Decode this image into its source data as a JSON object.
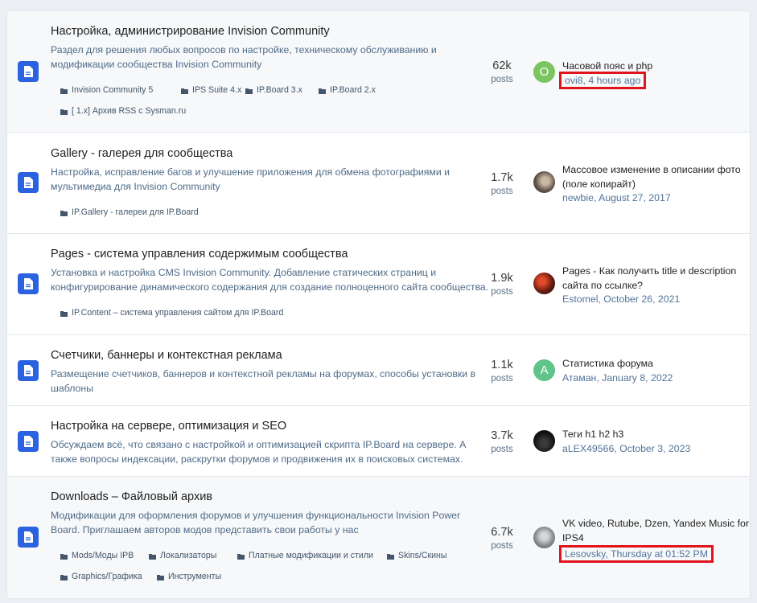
{
  "forums": [
    {
      "title": "Настройка, администрирование Invision Community",
      "description": "Раздел для решения любых вопросов по настройке, техническому обслуживанию и модификации сообщества Invision Community",
      "subforums": [
        "Invision Community 5",
        "IPS Suite 4.x",
        "IP.Board 3.x",
        "IP.Board 2.x",
        "[ 1.x] Архив RSS с Sysman.ru"
      ],
      "posts_count": "62k",
      "posts_label": "posts",
      "last_post_title": "Часовой пояс и php",
      "last_post_meta": "ovi8, 4 hours ago",
      "avatar_letter": "O",
      "avatar_color": "#7cc460"
    },
    {
      "title": "Gallery - галерея для сообщества",
      "description": "Настройка, исправление багов и улучшение приложения для обмена фотографиями и мультимедиа для Invision Community",
      "subforums": [
        "IP.Gallery - галереи для IP.Board"
      ],
      "posts_count": "1.7k",
      "posts_label": "posts",
      "last_post_title": "Массовое изменение в описании фото (поле копирайт)",
      "last_post_meta": "newbie, August 27, 2017",
      "avatar_letter": "",
      "avatar_color": "#5b4d43"
    },
    {
      "title": "Pages - система управления содержимым сообщества",
      "description": "Установка и настройка CMS Invision Community. Добавление статических страниц и конфигурирование динамического содержания для создание полноценного сайта сообщества.",
      "subforums": [
        "IP.Content – система управления сайтом для IP.Board"
      ],
      "posts_count": "1.9k",
      "posts_label": "posts",
      "last_post_title": "Pages - Как получить title и description сайта по ссылке?",
      "last_post_meta": "Estomel, October 26, 2021",
      "avatar_letter": "",
      "avatar_color": "#7a2216"
    },
    {
      "title": "Счетчики, баннеры и контекстная реклама",
      "description": "Размещение счетчиков, баннеров и контекстной рекламы на форумах, способы установки в шаблоны",
      "subforums": [],
      "posts_count": "1.1k",
      "posts_label": "posts",
      "last_post_title": "Статистика форума",
      "last_post_meta": "Атаман, January 8, 2022",
      "avatar_letter": "A",
      "avatar_color": "#5fc489"
    },
    {
      "title": "Настройка на сервере, оптимизация и SEO",
      "description": "Обсуждаем всё, что связано с настройкой и оптимизацией скрипта IP.Board на сервере. А также вопросы индексации, раскрутки форумов и продвижения их в поисковых системах.",
      "subforums": [],
      "posts_count": "3.7k",
      "posts_label": "posts",
      "last_post_title": "Теги h1 h2 h3",
      "last_post_meta": "aLEX49566, October 3, 2023",
      "avatar_letter": "",
      "avatar_color": "#111111"
    },
    {
      "title": "Downloads – Файловый архив",
      "description": "Модификации для оформления форумов и улучшения функциональности Invision Power Board. Приглашаем авторов модов представить свои работы у нас",
      "subforums": [
        "Mods/Моды IPB",
        "Локализаторы",
        "Платные модификации и стили",
        "Skins/Скины",
        "Graphics/Графика",
        "Инструменты"
      ],
      "posts_count": "6.7k",
      "posts_label": "posts",
      "last_post_title": "VK video, Rutube, Dzen, Yandex Music for IPS4",
      "last_post_meta": "Lesovsky, Thursday at 01:52 PM",
      "avatar_letter": "",
      "avatar_color": "#8c9096"
    }
  ],
  "colors": {
    "forum_icon": "#2a62e0",
    "highlight_box": "#e1141b",
    "link_meta": "#52739a"
  },
  "icons": {
    "forum_icon": "document-icon",
    "subforum_icon": "folder-icon"
  }
}
